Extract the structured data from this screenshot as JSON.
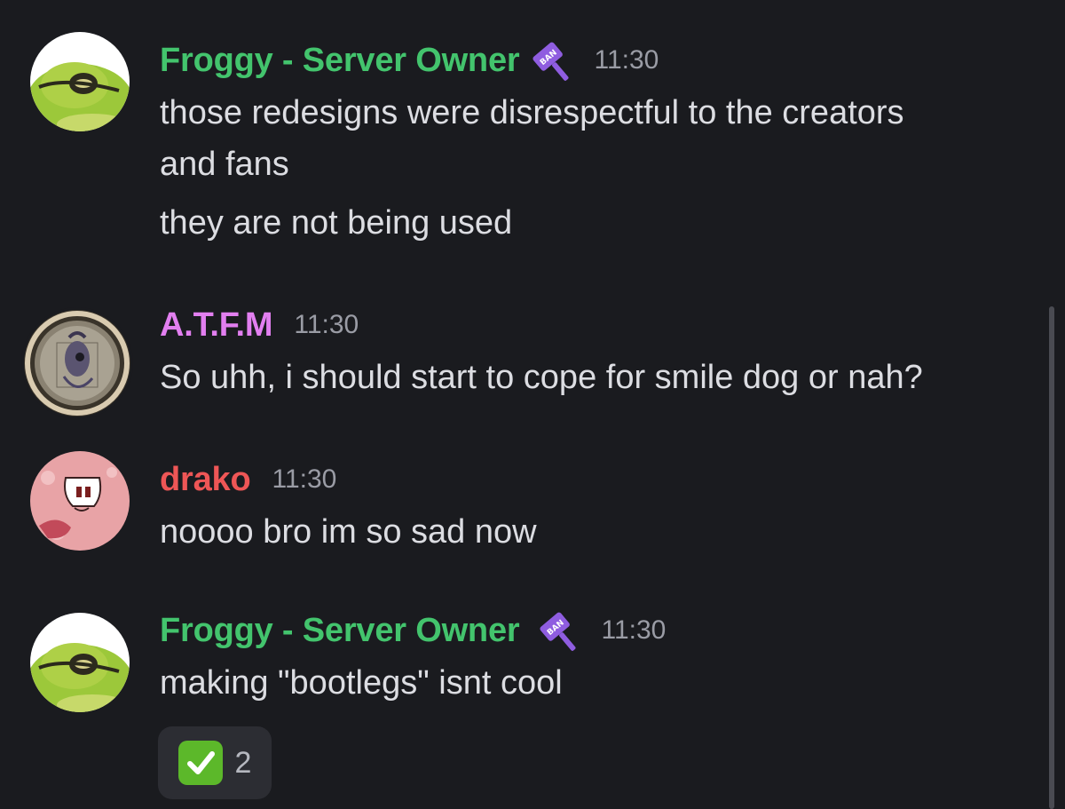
{
  "messages": [
    {
      "username": "Froggy - Server Owner",
      "username_color": "#43c46d",
      "role_icon": "ban-hammer-icon",
      "timestamp": "11:30",
      "lines": [
        "those redesigns were disrespectful to the creators",
        "and fans",
        "they are not being used"
      ]
    },
    {
      "username": "A.T.F.M",
      "username_color": "#e27ff0",
      "timestamp": "11:30",
      "lines": [
        "So uhh, i should start to cope for smile dog or  nah?"
      ]
    },
    {
      "username": "drako",
      "username_color": "#ee5656",
      "timestamp": "11:30",
      "lines": [
        "noooo bro im so sad now"
      ]
    },
    {
      "username": "Froggy - Server Owner",
      "username_color": "#43c46d",
      "role_icon": "ban-hammer-icon",
      "timestamp": "11:30",
      "lines": [
        "making \"bootlegs\" isnt cool"
      ],
      "reaction": {
        "emoji": "check-mark-icon",
        "count": "2"
      }
    }
  ],
  "colors": {
    "background": "#1a1b1f",
    "message_text": "#dcdde2",
    "timestamp": "#9a9ca5",
    "reaction_bg": "#2c2d33",
    "ban_icon": "#8f5de0"
  }
}
